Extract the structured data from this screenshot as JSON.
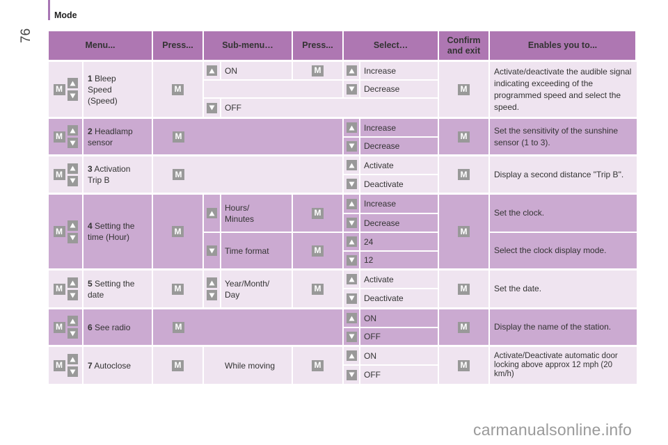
{
  "page": {
    "number": "76",
    "section_title": "Mode",
    "watermark": "carmanualsonline.info"
  },
  "colors": {
    "header": "#ae77b2",
    "row_light": "#efe4f0",
    "row_dark": "#cbaad1",
    "key": "#999999"
  },
  "icons": {
    "m_key": "M",
    "up_key": "up-arrow-icon",
    "down_key": "down-arrow-icon"
  },
  "table": {
    "headers": [
      "Menu...",
      "Press...",
      "Sub-menu…",
      "Press...",
      "Select…",
      "Confirm and exit",
      "Enables you to..."
    ],
    "rows": [
      {
        "num": "1",
        "menu": "Bleep Speed (Speed)",
        "submenu": [
          {
            "key": "up",
            "label": "ON"
          },
          {
            "key": "down",
            "label": "OFF"
          }
        ],
        "select": [
          {
            "key": "up",
            "label": "Increase"
          },
          {
            "key": "down",
            "label": "Decrease"
          }
        ],
        "enables": "Activate/deactivate the audible signal indicating exceeding of the programmed speed and select the speed."
      },
      {
        "num": "2",
        "menu": "Headlamp sensor",
        "select": [
          {
            "key": "up",
            "label": "Increase"
          },
          {
            "key": "down",
            "label": "Decrease"
          }
        ],
        "enables": "Set the sensitivity of the sunshine sensor (1 to 3)."
      },
      {
        "num": "3",
        "menu": "Activation Trip B",
        "select": [
          {
            "key": "up",
            "label": "Activate"
          },
          {
            "key": "down",
            "label": "Deactivate"
          }
        ],
        "enables": "Display a second distance \"Trip B\"."
      },
      {
        "num": "4",
        "menu": "Setting the time (Hour)",
        "submenu": [
          {
            "key": "up",
            "label": "Hours/ Minutes"
          },
          {
            "key": "down",
            "label": "Time format"
          }
        ],
        "select": [
          {
            "key": "up",
            "label": "Increase"
          },
          {
            "key": "down",
            "label": "Decrease"
          },
          {
            "key": "up",
            "label": "24"
          },
          {
            "key": "down",
            "label": "12"
          }
        ],
        "enables": [
          "Set the clock.",
          "Select the clock display mode."
        ]
      },
      {
        "num": "5",
        "menu": "Setting the date",
        "submenu": [
          {
            "key": "up-down",
            "label": "Year/Month/ Day"
          }
        ],
        "select": [
          {
            "key": "up",
            "label": "Activate"
          },
          {
            "key": "down",
            "label": "Deactivate"
          }
        ],
        "enables": "Set the date."
      },
      {
        "num": "6",
        "menu": "See radio",
        "select": [
          {
            "key": "up",
            "label": "ON"
          },
          {
            "key": "down",
            "label": "OFF"
          }
        ],
        "enables": "Display the name of the station."
      },
      {
        "num": "7",
        "menu": "Autoclose",
        "submenu": [
          {
            "key": "",
            "label": "While moving"
          }
        ],
        "select": [
          {
            "key": "up",
            "label": "ON"
          },
          {
            "key": "down",
            "label": "OFF"
          }
        ],
        "enables": "Activate/Deactivate automatic door locking above approx 12 mph (20 km/h)"
      }
    ]
  }
}
